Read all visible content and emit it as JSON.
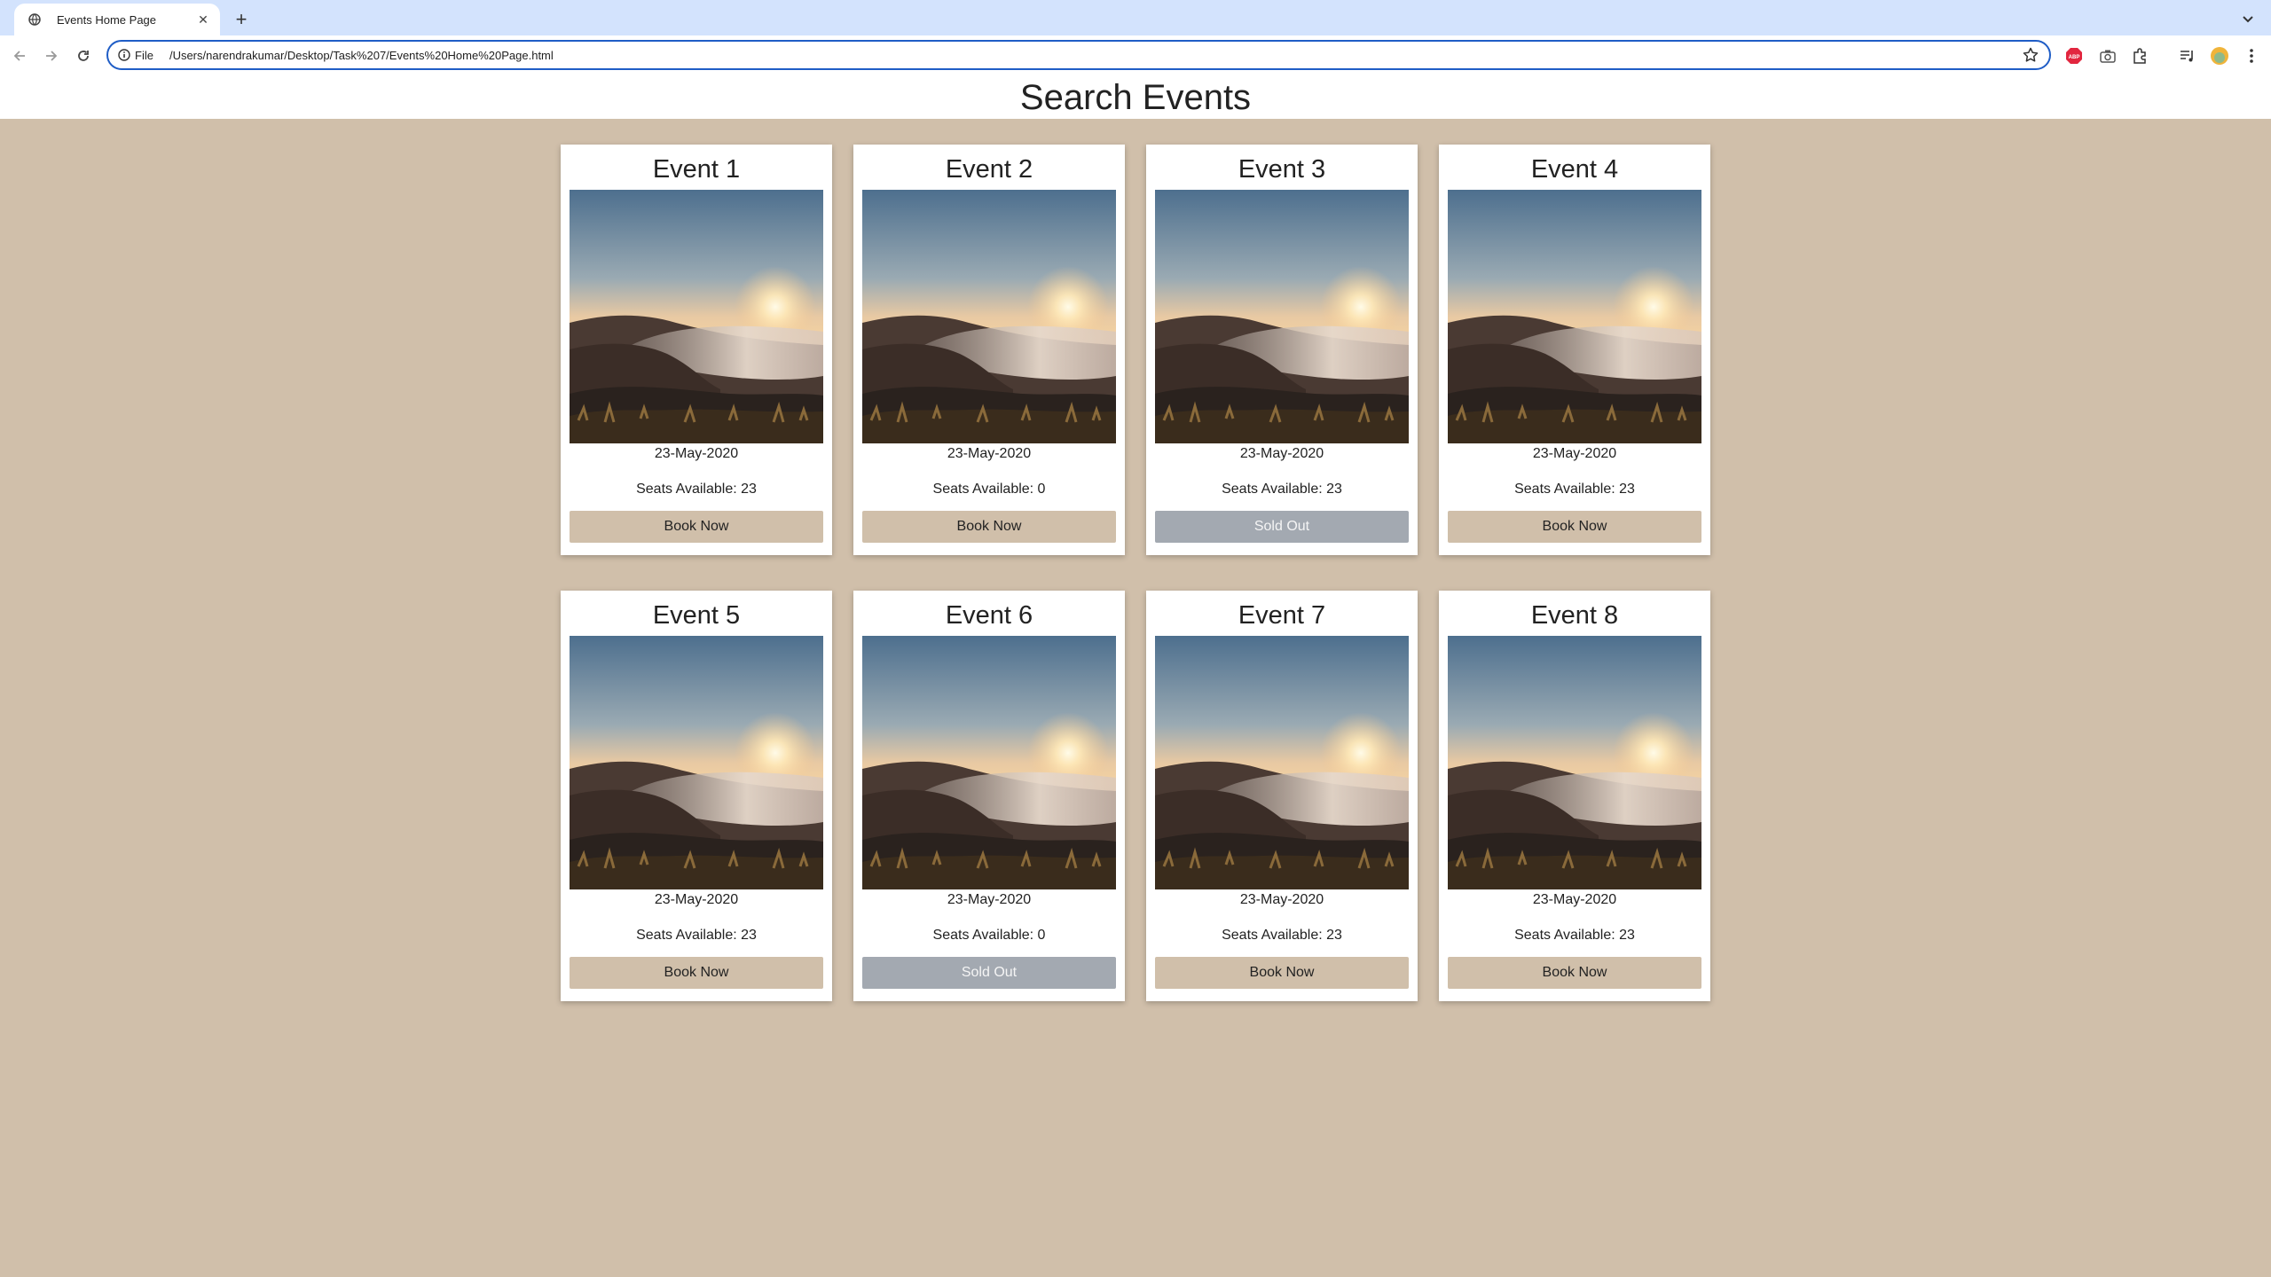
{
  "browser": {
    "tab_title": "Events Home Page",
    "omnibox_scheme": "File",
    "url": "/Users/narendrakumar/Desktop/Task%207/Events%20Home%20Page.html",
    "icons": [
      "globe-icon",
      "close-icon",
      "plus-icon",
      "chevron-down-icon",
      "back-icon",
      "forward-icon",
      "reload-icon",
      "info-icon",
      "star-icon",
      "adblock-icon",
      "camera-icon",
      "puzzle-icon",
      "media-icon",
      "avatar",
      "more-icon"
    ]
  },
  "page": {
    "title": "Search Events"
  },
  "theme": {
    "background": "#d0bfaa",
    "book_button": "#d0bfaa",
    "sold_button": "#a3a9b1",
    "accent": "#1f5dc6"
  },
  "events": [
    {
      "title": "Event 1",
      "date": "23-May-2020",
      "seats": "Seats Available: 23",
      "button": "Book Now",
      "sold_out": false
    },
    {
      "title": "Event 2",
      "date": "23-May-2020",
      "seats": "Seats Available: 0",
      "button": "Book Now",
      "sold_out": false
    },
    {
      "title": "Event 3",
      "date": "23-May-2020",
      "seats": "Seats Available: 23",
      "button": "Sold Out",
      "sold_out": true
    },
    {
      "title": "Event 4",
      "date": "23-May-2020",
      "seats": "Seats Available: 23",
      "button": "Book Now",
      "sold_out": false
    },
    {
      "title": "Event 5",
      "date": "23-May-2020",
      "seats": "Seats Available: 23",
      "button": "Book Now",
      "sold_out": false
    },
    {
      "title": "Event 6",
      "date": "23-May-2020",
      "seats": "Seats Available: 0",
      "button": "Sold Out",
      "sold_out": true
    },
    {
      "title": "Event 7",
      "date": "23-May-2020",
      "seats": "Seats Available: 23",
      "button": "Book Now",
      "sold_out": false
    },
    {
      "title": "Event 8",
      "date": "23-May-2020",
      "seats": "Seats Available: 23",
      "button": "Book Now",
      "sold_out": false
    }
  ]
}
